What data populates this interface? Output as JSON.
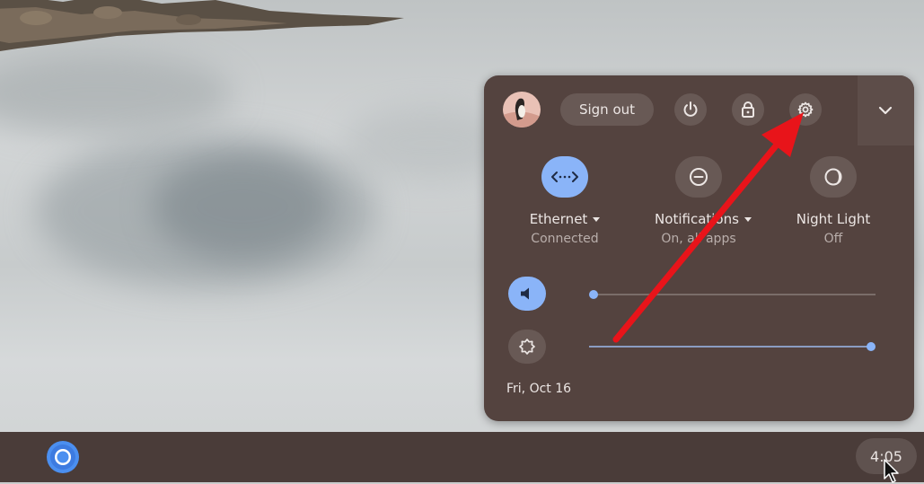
{
  "quick_settings": {
    "sign_out_label": "Sign out",
    "ethernet": {
      "label": "Ethernet",
      "status": "Connected",
      "icon": "ethernet-icon",
      "active": true
    },
    "notifications": {
      "label": "Notifications",
      "status": "On, all apps",
      "icon": "do-not-disturb-icon",
      "active": false
    },
    "night_light": {
      "label": "Night Light",
      "status": "Off",
      "icon": "night-light-icon",
      "active": false
    },
    "volume_level": 0.0,
    "brightness_level": 1.0,
    "date": "Fri, Oct 16"
  },
  "shelf": {
    "clock": "4:05",
    "launcher_app": "chrome-icon"
  },
  "colors": {
    "panel_bg": "#54433f",
    "accent": "#8ab4f8",
    "annotation_arrow": "#e8141a"
  }
}
